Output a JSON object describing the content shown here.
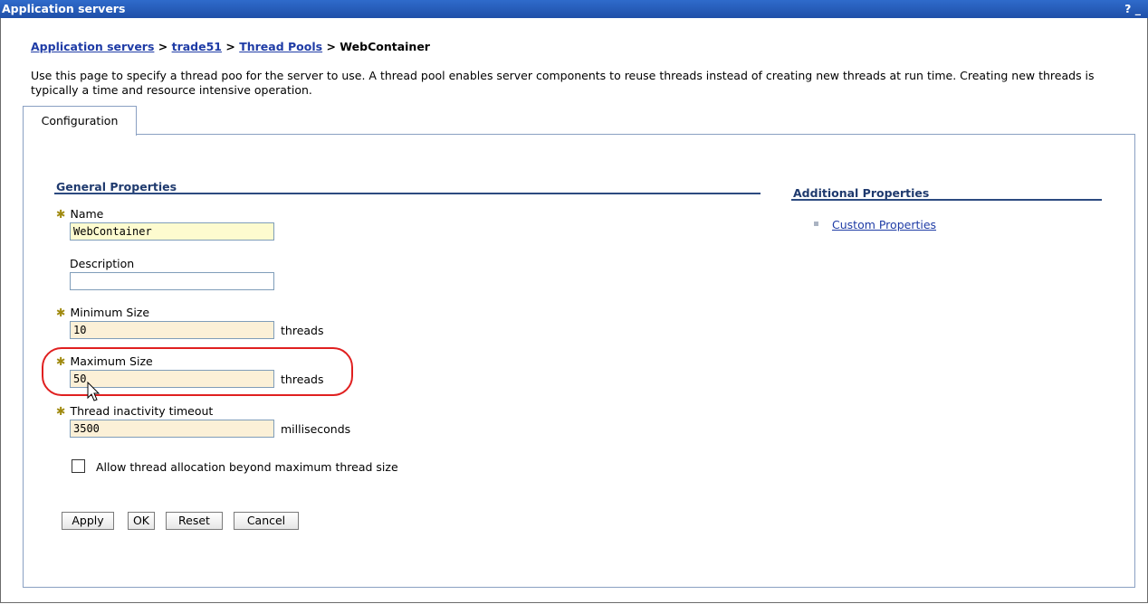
{
  "window": {
    "title": "Application servers",
    "help_label": "? _"
  },
  "breadcrumb": {
    "items": [
      "Application servers",
      "trade51",
      "Thread Pools"
    ],
    "separator": ">",
    "current": "WebContainer"
  },
  "intro": "Use this page to specify a thread poo for the server to use. A thread pool enables server components to reuse threads instead of creating new threads at run time. Creating new threads is typically a time and resource intensive operation.",
  "tabs": [
    {
      "label": "Configuration",
      "active": true
    }
  ],
  "general": {
    "title": "General Properties",
    "name": {
      "label": "Name",
      "value": "WebContainer",
      "required": true
    },
    "description": {
      "label": "Description",
      "value": ""
    },
    "min_size": {
      "label": "Minimum Size",
      "value": "10",
      "unit": "threads",
      "required": true
    },
    "max_size": {
      "label": "Maximum Size",
      "value": "50",
      "unit": "threads",
      "required": true
    },
    "timeout": {
      "label": "Thread inactivity timeout",
      "value": "3500",
      "unit": "milliseconds",
      "required": true
    },
    "allow_beyond": {
      "label": "Allow thread allocation beyond maximum thread size",
      "checked": false
    }
  },
  "buttons": {
    "apply": "Apply",
    "ok": "OK",
    "reset": "Reset",
    "cancel": "Cancel"
  },
  "additional": {
    "title": "Additional Properties",
    "links": [
      "Custom Properties"
    ]
  },
  "colors": {
    "titlebar": "#1f4fa8",
    "link": "#1f3ca6",
    "highlight": "#e02020"
  }
}
